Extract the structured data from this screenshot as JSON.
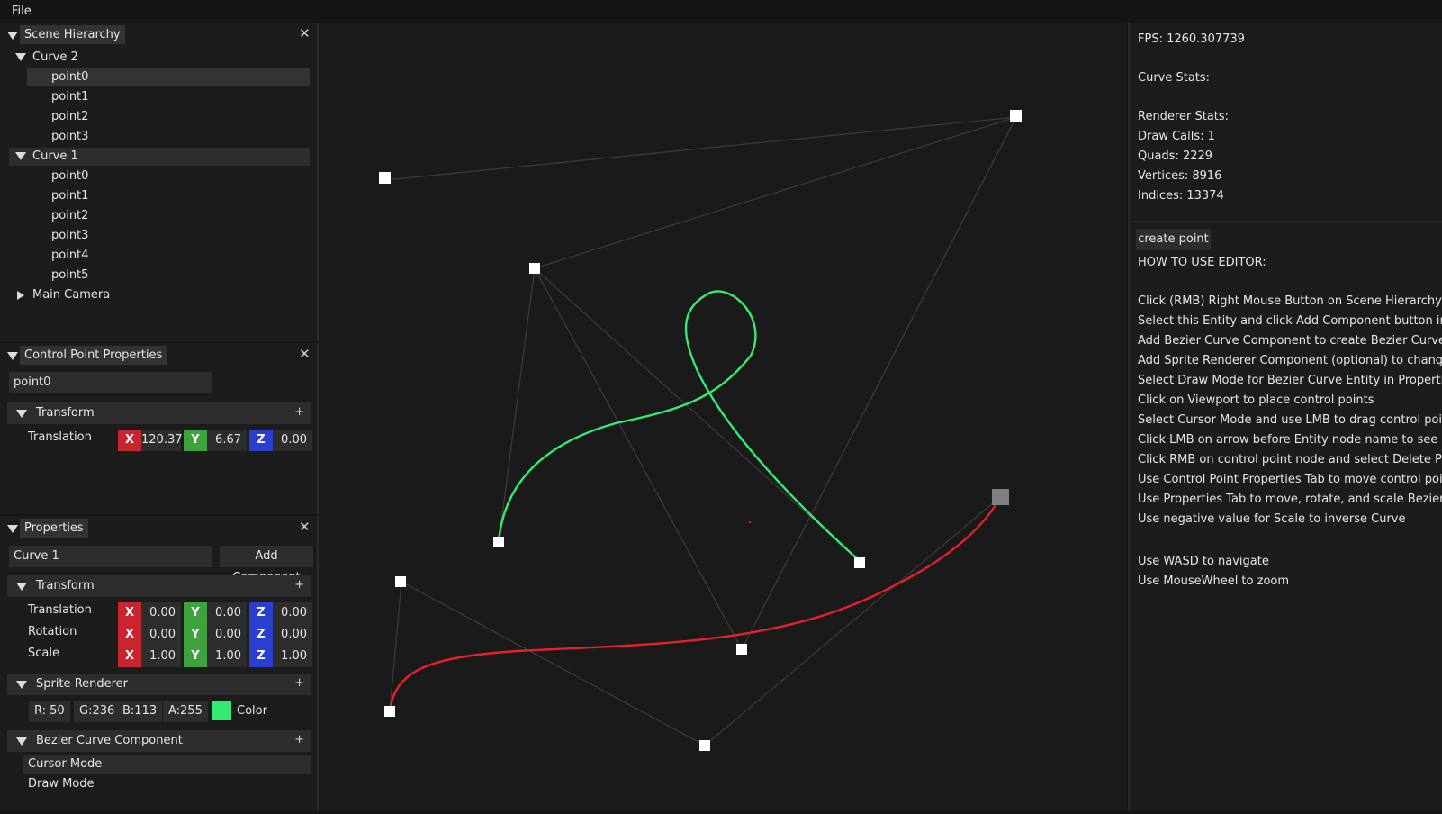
{
  "menu": {
    "file": "File"
  },
  "hierarchy": {
    "title": "Scene Hierarchy",
    "items": [
      {
        "label": "Curve 2",
        "indent": 0,
        "expanded": true
      },
      {
        "label": "point0",
        "indent": 1,
        "selected": true
      },
      {
        "label": "point1",
        "indent": 1
      },
      {
        "label": "point2",
        "indent": 1
      },
      {
        "label": "point3",
        "indent": 1
      },
      {
        "label": "Curve 1",
        "indent": 0,
        "expanded": true
      },
      {
        "label": "point0",
        "indent": 1
      },
      {
        "label": "point1",
        "indent": 1
      },
      {
        "label": "point2",
        "indent": 1
      },
      {
        "label": "point3",
        "indent": 1
      },
      {
        "label": "point4",
        "indent": 1
      },
      {
        "label": "point5",
        "indent": 1
      },
      {
        "label": "Main Camera",
        "indent": 0,
        "expanded": false
      }
    ]
  },
  "control_point": {
    "title": "Control Point Properties",
    "name": "point0",
    "transform_label": "Transform",
    "translation_label": "Translation",
    "translation": {
      "x": "120.37",
      "y": "6.67",
      "z": "0.00"
    }
  },
  "properties": {
    "title": "Properties",
    "name": "Curve 1",
    "add_component": "Add Component",
    "transform_label": "Transform",
    "translation_label": "Translation",
    "rotation_label": "Rotation",
    "scale_label": "Scale",
    "translation": {
      "x": "0.00",
      "y": "0.00",
      "z": "0.00"
    },
    "rotation": {
      "x": "0.00",
      "y": "0.00",
      "z": "0.00"
    },
    "scale": {
      "x": "1.00",
      "y": "1.00",
      "z": "1.00"
    },
    "sprite_renderer_label": "Sprite Renderer",
    "r": "R: 50",
    "g": "G:236",
    "b": "B:113",
    "a": "A:255",
    "color_label": "Color",
    "swatch_color": "#32ec71",
    "bezier_label": "Bezier Curve Component",
    "cursor_mode": "Cursor Mode",
    "draw_mode": "Draw Mode"
  },
  "axis_labels": {
    "x": "X",
    "y": "Y",
    "z": "Z"
  },
  "stats": {
    "fps": "FPS: 1260.307739",
    "curve_stats": "Curve Stats:",
    "renderer_stats": "Renderer Stats:",
    "draw_calls": "Draw Calls: 1",
    "quads": "Quads: 2229",
    "vertices": "Vertices: 8916",
    "indices": "Indices: 13374"
  },
  "help": {
    "create_point": "create point",
    "heading": "HOW TO USE EDITOR:",
    "lines": [
      "Click (RMB) Right Mouse Button on Scene Hierarchy -> (",
      "Select this Entity and click Add Component button in Pr",
      "Add Bezier Curve Component to create Bezier Curve",
      "Add Sprite Renderer Component (optional) to change c",
      "Select Draw Mode for Bezier Curve Entity in Properties",
      "Click on Viewport to place control points",
      "Select Cursor Mode and use LMB to drag control points",
      "Click LMB on arrow before Entity node name to see cor",
      "Click RMB on control point node and select Delete Poin",
      "Use Control Point Properties Tab to move control point",
      "Use Properties Tab to move, rotate, and scale Bezier Cu",
      "Use negative value for Scale to inverse Curve"
    ],
    "nav1": "Use WASD to navigate",
    "nav2": "Use MouseWheel to zoom"
  },
  "colors": {
    "curve_green": "#32ec71",
    "curve_red": "#e8202a",
    "guide_line": "#3a3a3a"
  }
}
